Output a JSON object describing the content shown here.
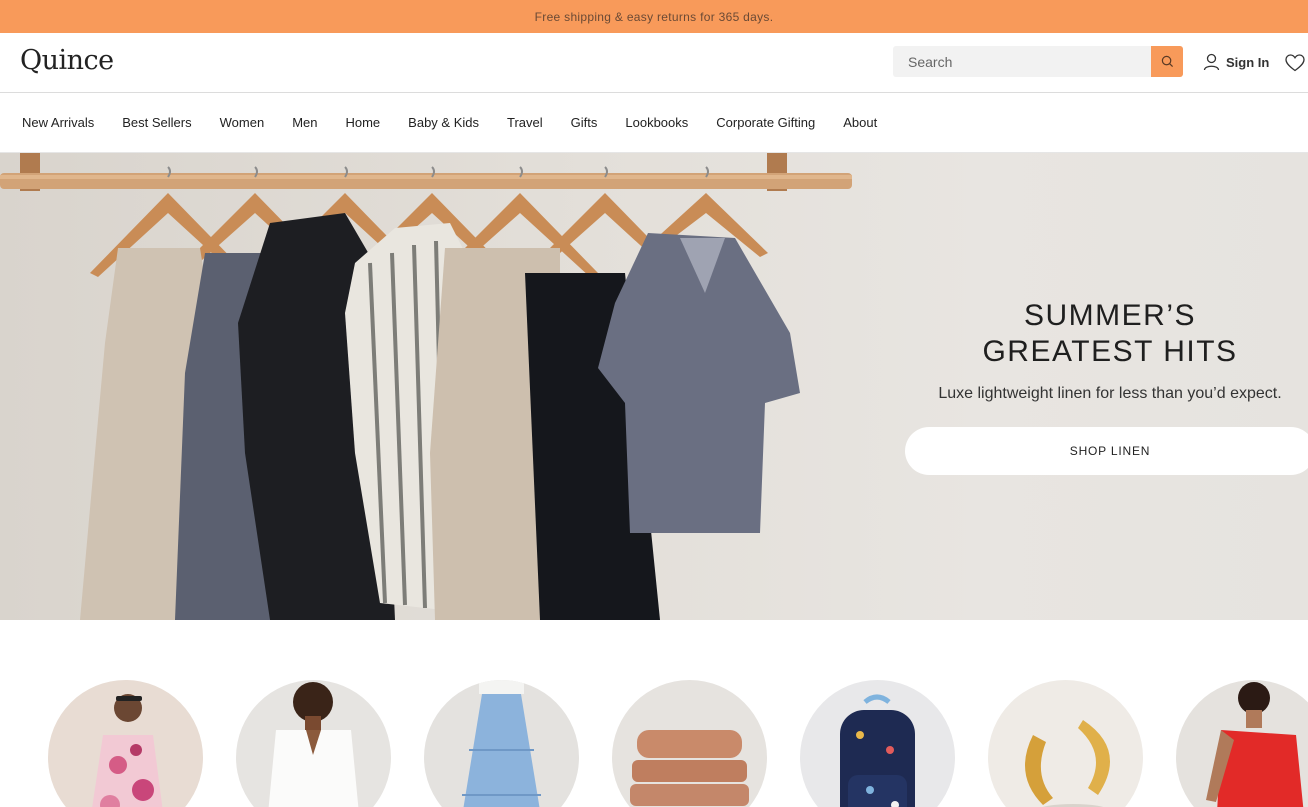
{
  "promo": {
    "text": "Free shipping & easy returns for 365 days."
  },
  "header": {
    "logo": "Quince",
    "search_placeholder": "Search",
    "signin_label": "Sign In"
  },
  "nav": {
    "items": [
      "New Arrivals",
      "Best Sellers",
      "Women",
      "Men",
      "Home",
      "Baby & Kids",
      "Travel",
      "Gifts",
      "Lookbooks",
      "Corporate Gifting",
      "About"
    ]
  },
  "hero": {
    "title_line1": "SUMMER’S",
    "title_line2": "GREATEST HITS",
    "subtitle": "Luxe lightweight linen for less than you’d expect.",
    "cta": "SHOP LINEN"
  },
  "colors": {
    "accent": "#f89a5a",
    "hero_bg": "#e4e1dd"
  },
  "categories": [
    {
      "icon": "floral-dress-photo"
    },
    {
      "icon": "white-shirt-photo"
    },
    {
      "icon": "blue-skirt-photo"
    },
    {
      "icon": "bedding-photo"
    },
    {
      "icon": "kids-backpack-photo"
    },
    {
      "icon": "gold-earrings-photo"
    },
    {
      "icon": "red-swimsuit-photo"
    }
  ]
}
